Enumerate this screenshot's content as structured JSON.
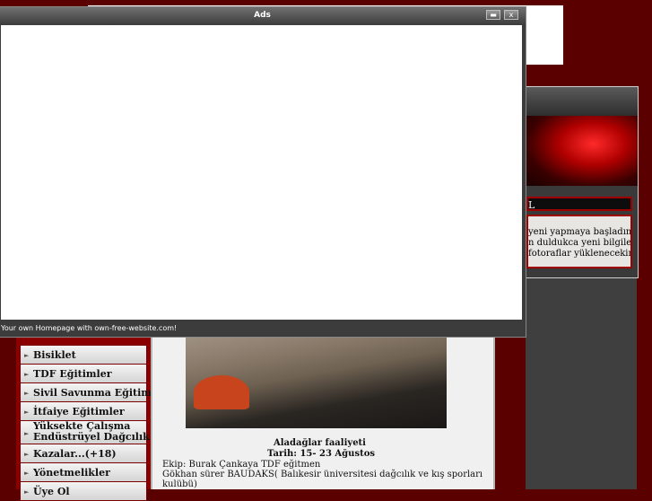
{
  "ads": {
    "title": "Ads",
    "minimize": "▬",
    "close": "x",
    "footer": "Your own Homepage with own-free-website.com!"
  },
  "right_panel": {
    "bar_text": "L",
    "box_lines": [
      "yeni yapmaya başladım",
      "n duldukca yeni bilgiler",
      "fotoraflar yüklenecekir...."
    ]
  },
  "menu": {
    "items": [
      {
        "label": "Bisiklet"
      },
      {
        "label": "TDF Eğitimler"
      },
      {
        "label": "Sivil Savunma Eğitimler"
      },
      {
        "label": "İtfaiye Eğitimler"
      },
      {
        "label": "Yüksekte Çalışma"
      },
      {
        "label": "Endüstrüyel Dağcılık"
      },
      {
        "label": "Kazalar...(+18)"
      },
      {
        "label": "Yönetmelikler"
      },
      {
        "label": "Üye Ol"
      }
    ]
  },
  "content": {
    "title": "Aladağlar faaliyeti",
    "date": "Tarih: 15- 23 Ağustos",
    "line1": "Ekip: Burak Çankaya TDF eğitmen",
    "line2": "Gökhan sürer BAUDAKS( Balıkesir üniversitesi dağcılık ve kış sporları",
    "line3": "kulübü)"
  }
}
